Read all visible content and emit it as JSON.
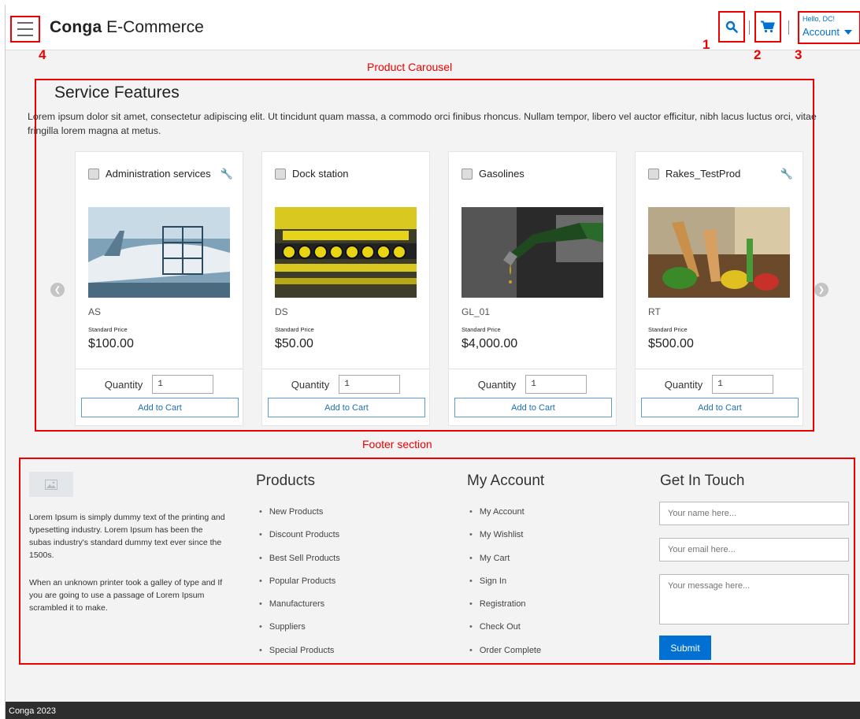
{
  "header": {
    "brand_bold": "Conga",
    "brand_rest": "E-Commerce",
    "account_greeting": "Hello, DC!",
    "account_label": "Account",
    "annotations": [
      "1",
      "2",
      "3",
      "4"
    ]
  },
  "carousel": {
    "annotation_label": "Product Carousel",
    "title": "Service Features",
    "description": "Lorem ipsum dolor sit amet, consectetur adipiscing elit. Ut tincidunt quam massa, a commodo orci finibus rhoncus. Nullam tempor, libero vel auctor efficitur, nibh lacus luctus orci, vitae fringilla lorem magna at metus.",
    "products": [
      {
        "name": "Administration services",
        "code": "AS",
        "price_label": "Standard Price",
        "price": "$100.00",
        "quantity_label": "Quantity",
        "quantity": "1",
        "add_label": "Add to Cart",
        "has_wrench": true
      },
      {
        "name": "Dock station",
        "code": "DS",
        "price_label": "Standard Price",
        "price": "$50.00",
        "quantity_label": "Quantity",
        "quantity": "1",
        "add_label": "Add to Cart",
        "has_wrench": false
      },
      {
        "name": "Gasolines",
        "code": "GL_01",
        "price_label": "Standard Price",
        "price": "$4,000.00",
        "quantity_label": "Quantity",
        "quantity": "1",
        "add_label": "Add to Cart",
        "has_wrench": false
      },
      {
        "name": "Rakes_TestProd",
        "code": "RT",
        "price_label": "Standard Price",
        "price": "$500.00",
        "quantity_label": "Quantity",
        "quantity": "1",
        "add_label": "Add to Cart",
        "has_wrench": true
      }
    ]
  },
  "footer": {
    "annotation_label": "Footer section",
    "about_p1": "Lorem Ipsum is simply dummy text of the printing and typesetting industry. Lorem Ipsum has been the subas industry's standard dummy text ever since the 1500s.",
    "about_p2": "When an unknown printer took a galley of type and If you are going to use a passage of Lorem Ipsum scrambled it to make.",
    "products_title": "Products",
    "products_links": [
      "New Products",
      "Discount Products",
      "Best Sell Products",
      "Popular Products",
      "Manufacturers",
      "Suppliers",
      "Special Products"
    ],
    "account_title": "My Account",
    "account_links": [
      "My Account",
      "My Wishlist",
      "My Cart",
      "Sign In",
      "Registration",
      "Check Out",
      "Order Complete"
    ],
    "contact_title": "Get In Touch",
    "name_placeholder": "Your name here...",
    "email_placeholder": "Your email here...",
    "message_placeholder": "Your message here...",
    "submit_label": "Submit"
  },
  "copyright": "Conga 2023",
  "colors": {
    "accent": "#0070d2",
    "annotation": "#e00000",
    "bottom_bar": "#2e2e2e"
  }
}
